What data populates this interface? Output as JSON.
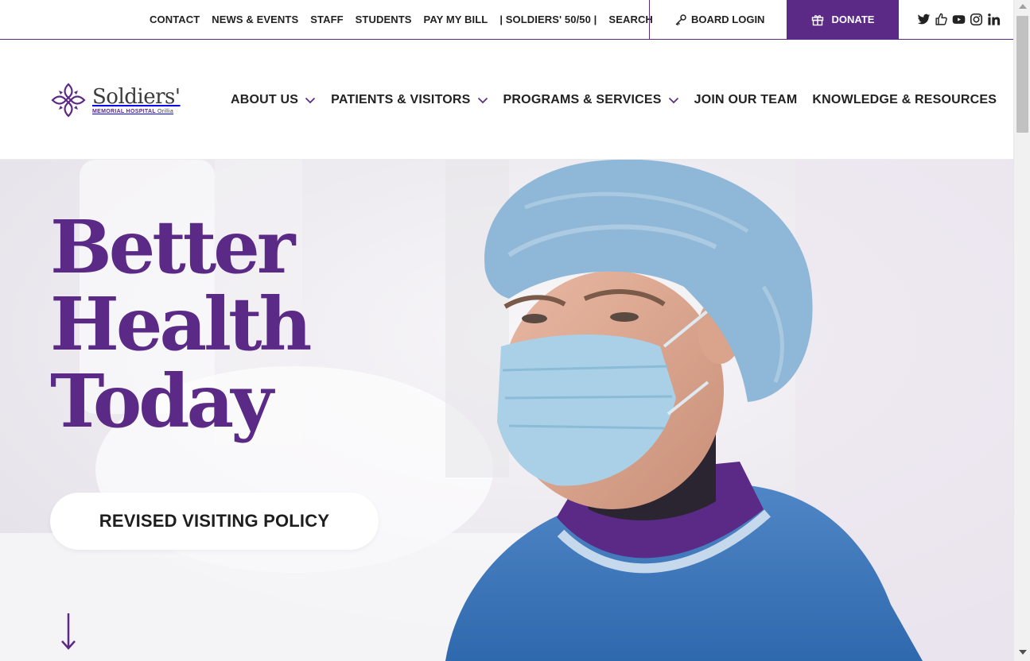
{
  "utility_nav": {
    "links": [
      "CONTACT",
      "NEWS & EVENTS",
      "STAFF",
      "STUDENTS",
      "PAY MY BILL",
      "| SOLDIERS' 50/50 |",
      "SEARCH"
    ],
    "board_login": "BOARD LOGIN",
    "donate": "DONATE",
    "social_icons": [
      "twitter-icon",
      "like-icon",
      "youtube-icon",
      "instagram-icon",
      "linkedin-icon"
    ]
  },
  "logo": {
    "name": "Soldiers'",
    "subtitle": "MEMORIAL HOSPITAL",
    "city": "Orillia"
  },
  "main_nav": [
    {
      "label": "ABOUT US",
      "has_dropdown": true
    },
    {
      "label": "PATIENTS & VISITORS",
      "has_dropdown": true
    },
    {
      "label": "PROGRAMS & SERVICES",
      "has_dropdown": true
    },
    {
      "label": "JOIN OUR TEAM",
      "has_dropdown": false
    },
    {
      "label": "KNOWLEDGE & RESOURCES",
      "has_dropdown": false
    }
  ],
  "hero": {
    "headline": [
      "Better",
      "Health",
      "Today"
    ],
    "cta": "REVISED VISITING POLICY",
    "scroll_icon": "arrow-down-icon"
  },
  "colors": {
    "brand_purple": "#5b2a86",
    "text_dark": "#1e1e1e",
    "white": "#ffffff"
  }
}
